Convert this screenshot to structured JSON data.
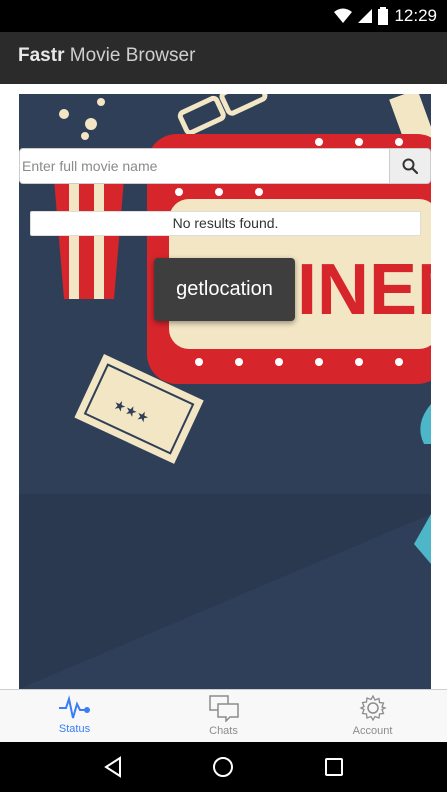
{
  "status_bar": {
    "time": "12:29"
  },
  "app": {
    "brand": "Fastr",
    "title_rest": " Movie Browser"
  },
  "search": {
    "placeholder": "Enter full movie name",
    "value": ""
  },
  "results": {
    "message": "No results found."
  },
  "toast": {
    "text": "getlocation"
  },
  "poster": {
    "marquee_text": "SINEM"
  },
  "tabs": [
    {
      "label": "Status",
      "icon": "pulse-icon",
      "active": true
    },
    {
      "label": "Chats",
      "icon": "chat-bubbles-icon",
      "active": false
    },
    {
      "label": "Account",
      "icon": "gear-icon",
      "active": false
    }
  ],
  "colors": {
    "accent": "#387ef5",
    "header": "#2b2b2b",
    "poster_bg": "#2f3f57",
    "marquee_red": "#d6262b"
  }
}
